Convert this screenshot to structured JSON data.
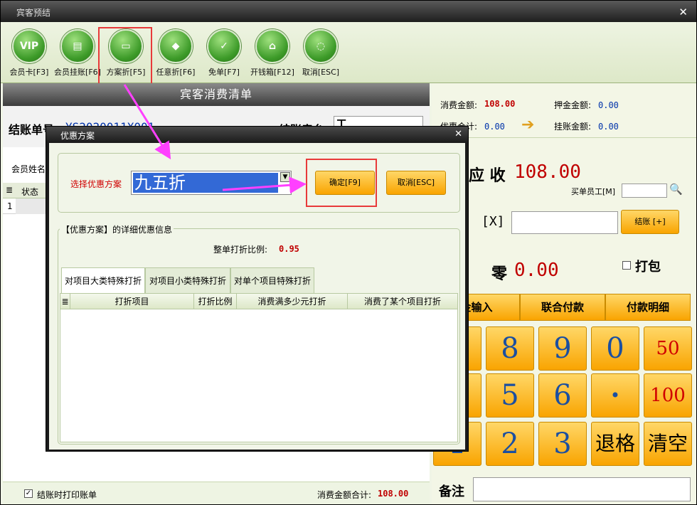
{
  "window": {
    "title": "宾客预结"
  },
  "toolbar": [
    {
      "label": "会员卡[F3]",
      "icon": "vip-icon",
      "glyph": "VIP"
    },
    {
      "label": "会员挂账[F6]",
      "icon": "document-icon",
      "glyph": "▤"
    },
    {
      "label": "方案折[F5]",
      "icon": "window-icon",
      "glyph": "▭"
    },
    {
      "label": "任意折[F6]",
      "icon": "bag-icon",
      "glyph": "◆"
    },
    {
      "label": "免单[F7]",
      "icon": "clipboard-check-icon",
      "glyph": "✓"
    },
    {
      "label": "开钱箱[F12]",
      "icon": "bank-icon",
      "glyph": "⌂"
    },
    {
      "label": "取消[ESC]",
      "icon": "loading-circle-icon",
      "glyph": "◌"
    }
  ],
  "left": {
    "header": "宾客消费清单",
    "bill_no_label": "结账单号",
    "bill_no_value": "YS2020011X001",
    "cashier_label": "结账房台",
    "cashier_value": "T",
    "member_name_label": "会员姓名",
    "grid_header_status": "状态",
    "grid_row_num": "1",
    "print_label": "结账时打印账单",
    "print_checked": true,
    "total_label": "消费金额合计:",
    "total_value": "108.00"
  },
  "right": {
    "consume_label": "消费金额:",
    "consume_value": "108.00",
    "deposit_label": "押金金额:",
    "deposit_value": "0.00",
    "discount_label": "优惠合计:",
    "discount_value": "0.00",
    "credit_label": "挂账金额:",
    "credit_value": "0.00",
    "receivable_label": "应 收",
    "receivable_value": "108.00",
    "staff_label": "买单员工[M]",
    "cash_label": "[X]",
    "checkout_label": "结账 [+]",
    "change_label": "零",
    "change_value": "0.00",
    "pack_label": "打包",
    "pay_tabs": [
      "金输入",
      "联合付款",
      "付款明细"
    ],
    "keys": [
      [
        "",
        "8",
        "9",
        "0",
        "50"
      ],
      [
        "",
        "5",
        "6",
        "•",
        "100"
      ],
      [
        "1",
        "2",
        "3",
        "退格",
        "清空"
      ]
    ],
    "remark_label": "备注"
  },
  "dialog": {
    "title": "优惠方案",
    "select_label": "选择优惠方案",
    "select_value": "九五折",
    "ok_label": "确定[F9]",
    "cancel_label": "取消[ESC]",
    "detail_title": "【优惠方案】的详细优惠信息",
    "ratio_label": "整单打折比例:",
    "ratio_value": "0.95",
    "tabs": [
      "对项目大类特殊打折",
      "对项目小类特殊打折",
      "对单个项目特殊打折"
    ],
    "columns": [
      "打折项目",
      "打折比例",
      "消费满多少元打折",
      "消费了某个项目打折"
    ]
  },
  "colors": {
    "accent": "#f9a400",
    "highlight": "#e83a3a",
    "arrow": "#ff40ff"
  }
}
